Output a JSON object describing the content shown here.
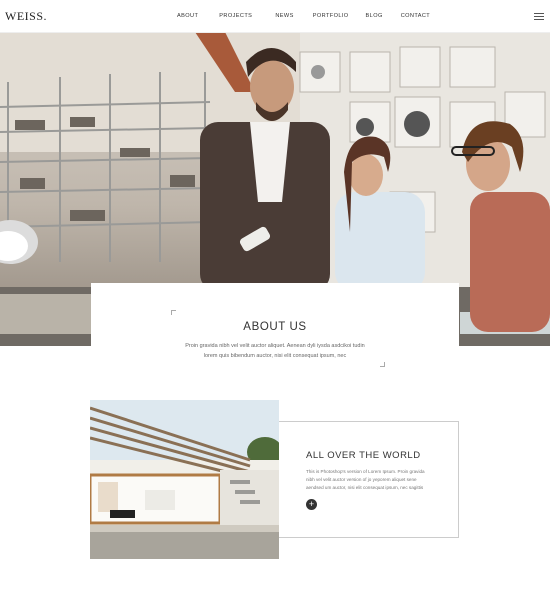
{
  "header": {
    "logo": "WEISS.",
    "nav": [
      "ABOUT",
      "PROJECTS",
      "NEWS",
      "PORTFOLIO",
      "BLOG",
      "CONTACT"
    ],
    "menu_icon": "hamburger-icon"
  },
  "hero": {
    "image": "office-team-photo"
  },
  "about": {
    "title": "ABOUT US",
    "text": "Proin gravida nibh vel velit auctor aliquet. Aenean dyli iysda asdcikoi tudin lorem quis bibendum auctor, nisi elit consequat ipsum, nec"
  },
  "feature": {
    "image": "modern-house-photo",
    "title": "ALL OVER THE WORLD",
    "text": "This is Photoshop's version  of Lorem Ipsum. Proin gravida nibh vel velit auctor version of jo yeporem aliquet sene aendsed um auctor, nisi elit consequat ipsum, nec sagittis",
    "button": "+"
  },
  "colors": {
    "accent": "#333333",
    "background": "#ffffff"
  }
}
